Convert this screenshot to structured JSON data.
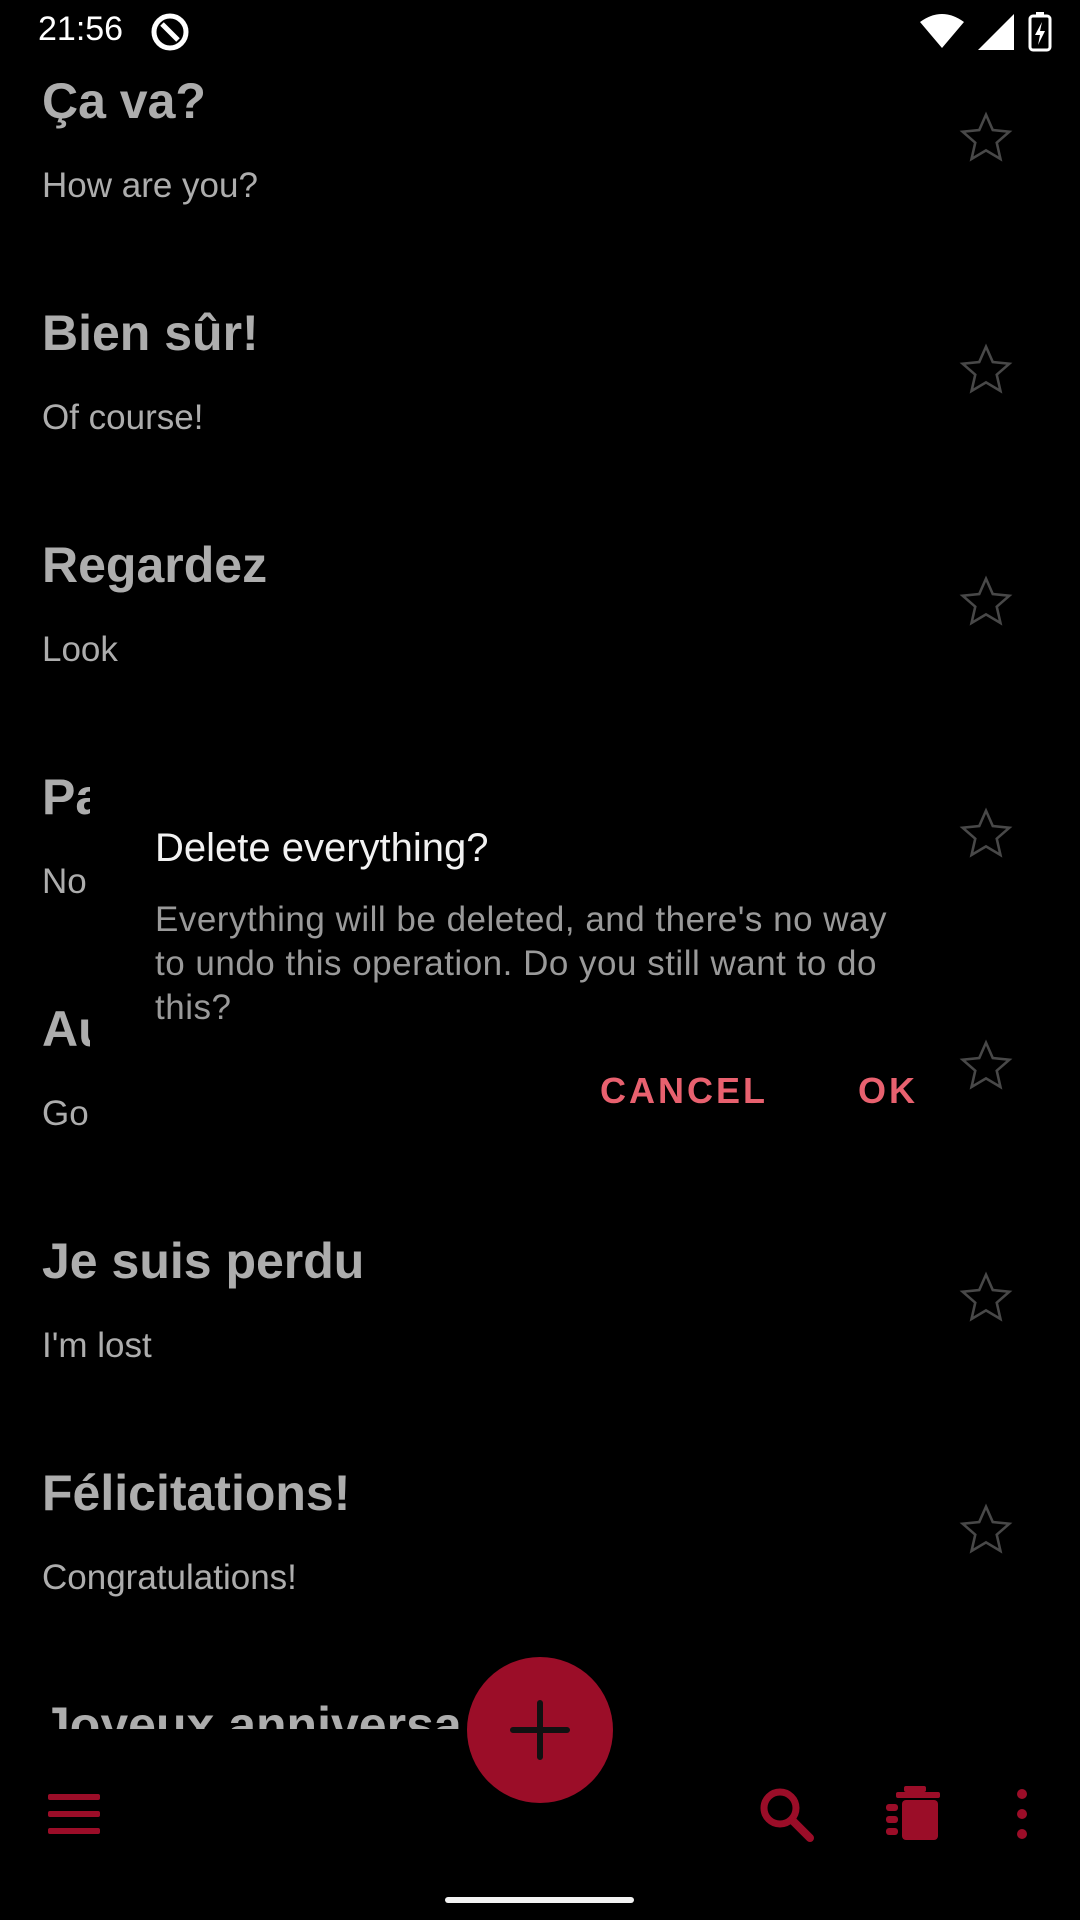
{
  "status_bar": {
    "time": "21:56"
  },
  "phrases": [
    {
      "title": "Ça va?",
      "translation": "How are you?"
    },
    {
      "title": "Bien sûr!",
      "translation": "Of course!"
    },
    {
      "title": "Regardez",
      "translation": "Look"
    },
    {
      "title": "Pa",
      "translation": "No"
    },
    {
      "title": "Au",
      "translation": "Go"
    },
    {
      "title": "Je suis perdu",
      "translation": "I'm lost"
    },
    {
      "title": "Félicitations!",
      "translation": "Congratulations!"
    },
    {
      "title": "Joyeux anniversa",
      "translation": ""
    }
  ],
  "dialog": {
    "title": "Delete everything?",
    "message": "Everything will be deleted, and there's no way to undo this operation. Do you still want to do this?",
    "cancel_label": "CANCEL",
    "ok_label": "OK"
  },
  "icons": {
    "fab": "plus-icon",
    "menu": "menu-icon",
    "search": "search-icon",
    "delete_all": "delete-all-icon",
    "more": "more-vert-icon"
  },
  "colors": {
    "accent": "#9b0d28",
    "dialog_button": "#e8616f"
  }
}
